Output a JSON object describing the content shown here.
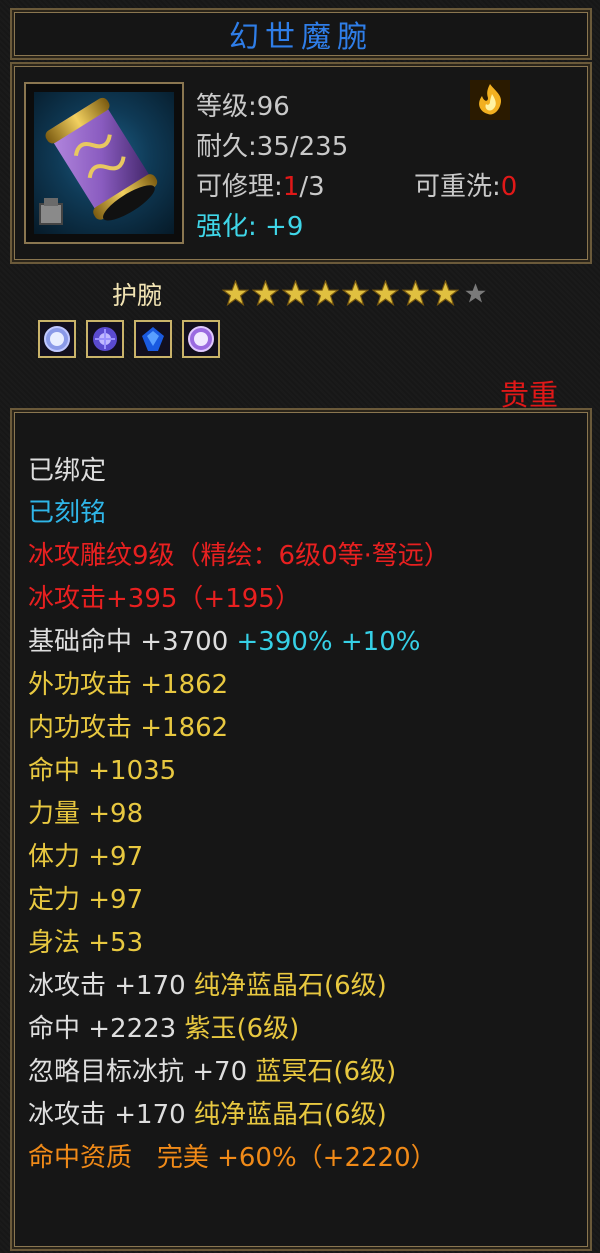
{
  "item": {
    "name": "幻世魔腕",
    "level_label": "等级:",
    "level_value": "96",
    "durability_label": "耐久:",
    "durability_value": "35/235",
    "repair_label": "可修理:",
    "repair_used": "1",
    "repair_total": "/3",
    "rewash_label": "可重洗:",
    "rewash_value": "0",
    "enhance_label": "强化:",
    "enhance_value": "+9",
    "type": "护腕",
    "stars": {
      "filled": 8,
      "total": 9
    },
    "gems": [
      "gem-blue-icon",
      "gem-purple-icon",
      "gem-sapphire-icon",
      "gem-violet-icon"
    ],
    "rarity": "贵重",
    "icon": "bracer-icon",
    "status_icon": "fire-icon"
  },
  "attributes": {
    "bound": "已绑定",
    "engraved": "已刻铭",
    "carving": "冰攻雕纹9级（精绘：6级0等·弩远）",
    "ice_attack": "冰攻击+395（+195）",
    "base_hit_label": "基础命中",
    "base_hit_value": "+3700",
    "base_hit_pct1": "+390%",
    "base_hit_pct2": "+10%",
    "outer_atk": "外功攻击 +1862",
    "inner_atk": "内功攻击 +1862",
    "hit": "命中 +1035",
    "strength": "力量 +98",
    "stamina": "体力 +97",
    "focus": "定力 +97",
    "agility": "身法 +53",
    "gem1_stat": "冰攻击 +170",
    "gem1_name": "纯净蓝晶石(6级)",
    "gem2_stat": "命中 +2223",
    "gem2_name": "紫玉(6级)",
    "gem3_stat": "忽略目标冰抗 +70",
    "gem3_name": "蓝冥石(6级)",
    "gem4_stat": "冰攻击 +170",
    "gem4_name": "纯净蓝晶石(6级)",
    "aptitude_label": "命中资质",
    "aptitude_grade": "完美",
    "aptitude_value": "+60%（+2220）"
  },
  "colors": {
    "title_blue": "#2f7ee8",
    "red": "#e01818",
    "cyan": "#36d0e6",
    "yellow": "#e8c840",
    "orange": "#f08a18",
    "frame_gold": "#8a7650"
  }
}
